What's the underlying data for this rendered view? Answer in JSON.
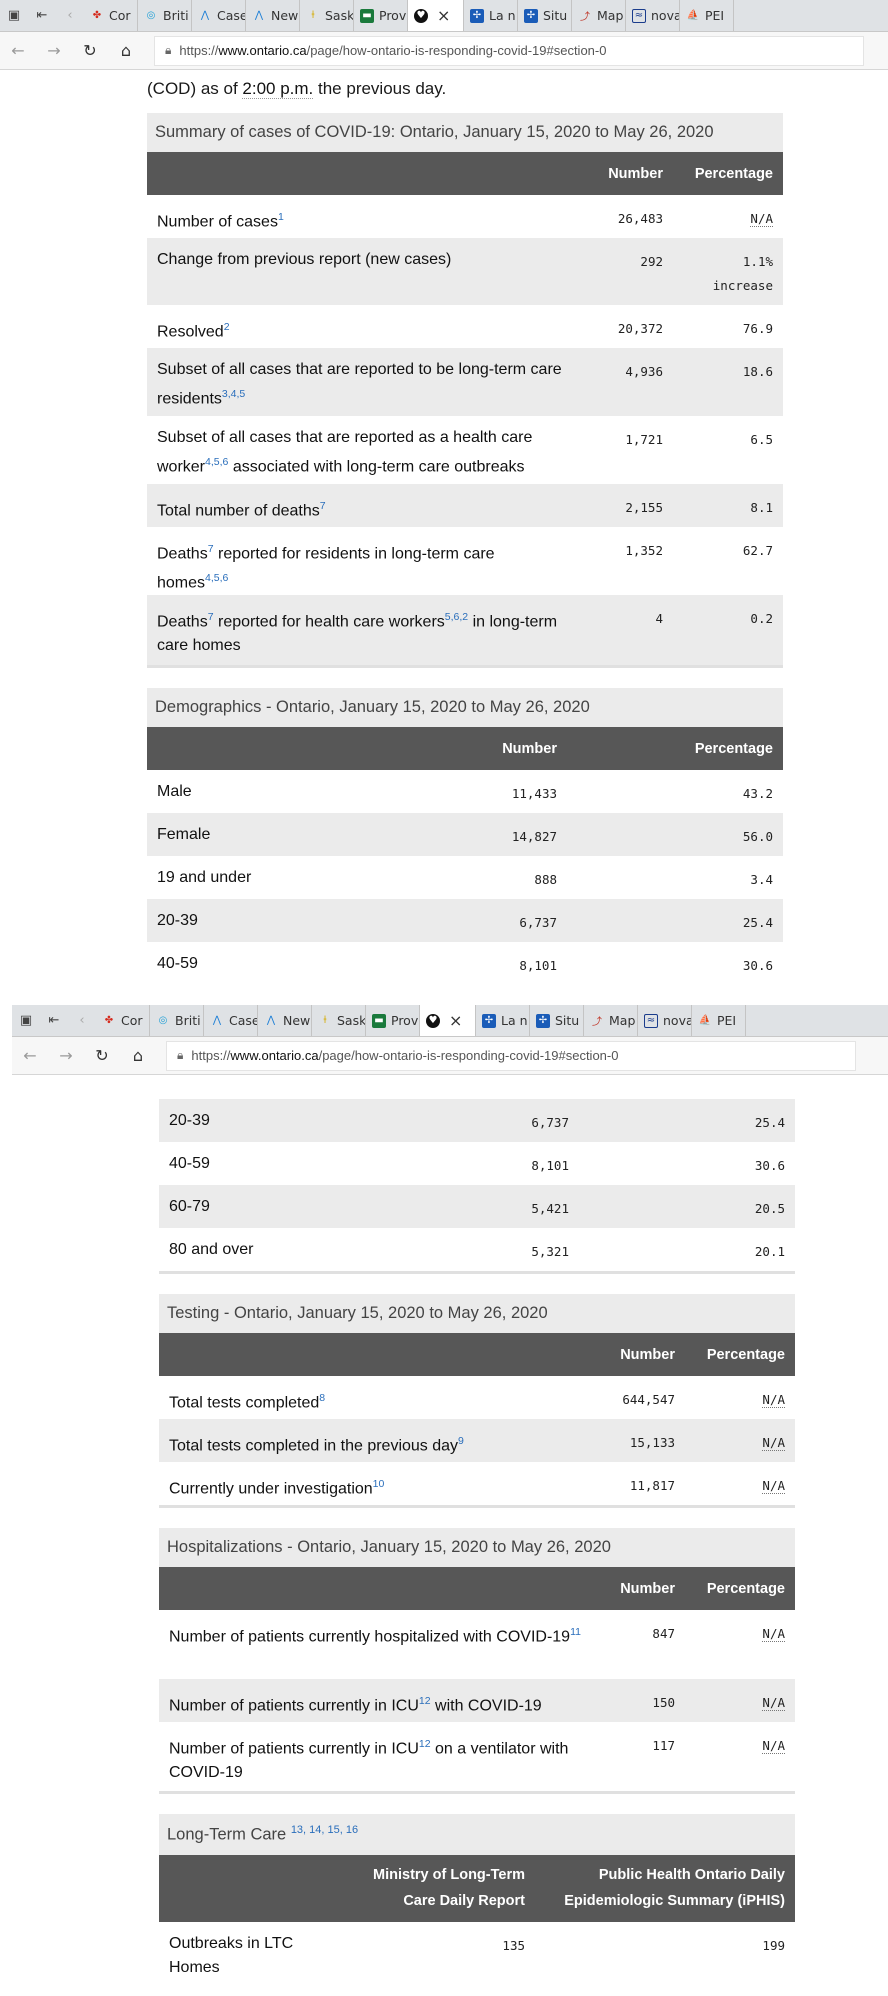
{
  "browser": {
    "tabs": [
      {
        "label": "Cor",
        "icon": "canada-flag-icon",
        "color": "#d52b1e"
      },
      {
        "label": "Briti",
        "icon": "bc-gov-icon",
        "color": "#1d9fd6"
      },
      {
        "label": "Case",
        "icon": "alberta-icon",
        "color": "#1d7fd6"
      },
      {
        "label": "New",
        "icon": "alberta-icon",
        "color": "#1d7fd6"
      },
      {
        "label": "Sask",
        "icon": "sask-icon",
        "color": "#d6b21d"
      },
      {
        "label": "Prov",
        "icon": "manitoba-icon",
        "color": "#1a7a3c"
      },
      {
        "label": "",
        "icon": "ontario-icon",
        "color": "#111111"
      },
      {
        "label": "La n",
        "icon": "quebec-icon",
        "color": "#1a5cb8"
      },
      {
        "label": "Situ",
        "icon": "quebec-icon",
        "color": "#1a5cb8"
      },
      {
        "label": "Map",
        "icon": "map-icon",
        "color": "#c0392b"
      },
      {
        "label": "nova",
        "icon": "nova-scotia-icon",
        "color": "#1a3c8c"
      },
      {
        "label": "PEI",
        "icon": "pei-icon",
        "color": "#2e8b57"
      }
    ],
    "url_prefix": "https://",
    "url_host": "www.ontario.ca",
    "url_path": "/page/how-ontario-is-responding-covid-19#section-0"
  },
  "top": {
    "intro_pre": "(COD) as of ",
    "intro_time": "2:00 p.m.",
    "intro_post": " the previous day."
  },
  "summary": {
    "caption": "Summary of cases of COVID-19: Ontario, January 15, 2020 to May 26, 2020",
    "col_number": "Number",
    "col_percentage": "Percentage",
    "rows": [
      {
        "label": "Number of cases",
        "sup": "1",
        "number": "26,483",
        "pct": "N/A"
      },
      {
        "label": "Change from previous report (new cases)",
        "sup": "",
        "number": "292",
        "pct": "1.1%",
        "pct2": "increase"
      },
      {
        "label": "Resolved",
        "sup": "2",
        "number": "20,372",
        "pct": "76.9"
      },
      {
        "label": "Subset of all cases that are reported to be long-term care residents",
        "sup": "3,4,5",
        "number": "4,936",
        "pct": "18.6"
      },
      {
        "label": "Subset of all cases that are reported as a health care worker",
        "sup": "4,5,6",
        "label2": " associated with long-term care outbreaks",
        "number": "1,721",
        "pct": "6.5"
      },
      {
        "label": "Total number of deaths",
        "sup": "7",
        "number": "2,155",
        "pct": "8.1"
      },
      {
        "label": "Deaths",
        "sup": "7",
        "label2": " reported for residents in long-term care homes",
        "sup2": "4,5,6",
        "number": "1,352",
        "pct": "62.7"
      },
      {
        "label": "Deaths",
        "sup": "7",
        "label2": " reported for health care workers",
        "sup2": "5,6,2",
        "label3": " in long-term care homes",
        "number": "4",
        "pct": "0.2"
      }
    ]
  },
  "demographics": {
    "caption": "Demographics - Ontario, January 15, 2020 to May 26, 2020",
    "col_number": "Number",
    "col_percentage": "Percentage",
    "rows": [
      {
        "label": "Male",
        "number": "11,433",
        "pct": "43.2"
      },
      {
        "label": "Female",
        "number": "14,827",
        "pct": "56.0"
      },
      {
        "label": "19 and under",
        "number": "888",
        "pct": "3.4"
      },
      {
        "label": "20-39",
        "number": "6,737",
        "pct": "25.4"
      },
      {
        "label": "40-59",
        "number": "8,101",
        "pct": "30.6"
      }
    ]
  },
  "demographics_cont": {
    "rows": [
      {
        "label": "20-39",
        "number": "6,737",
        "pct": "25.4"
      },
      {
        "label": "40-59",
        "number": "8,101",
        "pct": "30.6"
      },
      {
        "label": "60-79",
        "number": "5,421",
        "pct": "20.5"
      },
      {
        "label": "80 and over",
        "number": "5,321",
        "pct": "20.1"
      }
    ]
  },
  "testing": {
    "caption": "Testing - Ontario, January 15, 2020 to May 26, 2020",
    "col_number": "Number",
    "col_percentage": "Percentage",
    "rows": [
      {
        "label": "Total tests completed",
        "sup": "8",
        "number": "644,547",
        "pct": "N/A"
      },
      {
        "label": "Total tests completed in the previous day",
        "sup": "9",
        "number": "15,133",
        "pct": "N/A"
      },
      {
        "label": "Currently under investigation",
        "sup": "10",
        "number": "11,817",
        "pct": "N/A"
      }
    ]
  },
  "hospitalizations": {
    "caption": "Hospitalizations - Ontario, January 15, 2020 to May 26, 2020",
    "col_number": "Number",
    "col_percentage": "Percentage",
    "rows": [
      {
        "label": "Number of patients currently hospitalized with COVID-19",
        "sup": "11",
        "number": "847",
        "pct": "N/A"
      },
      {
        "label": "Number of patients currently in ICU",
        "sup": "12",
        "label2": " with COVID-19",
        "number": "150",
        "pct": "N/A"
      },
      {
        "label": "Number of patients currently in ICU",
        "sup": "12",
        "label2": " on a ventilator with COVID-19",
        "number": "117",
        "pct": "N/A"
      }
    ]
  },
  "ltc": {
    "caption": "Long-Term Care",
    "caption_sup": "13, 14, 15, 16",
    "col_ministry": "Ministry of Long-Term Care Daily Report",
    "col_pho": "Public Health Ontario Daily Epidemiologic Summary (iPHIS)",
    "rows": [
      {
        "label": "Outbreaks in LTC Homes",
        "ministry": "135",
        "pho": "199"
      }
    ]
  }
}
